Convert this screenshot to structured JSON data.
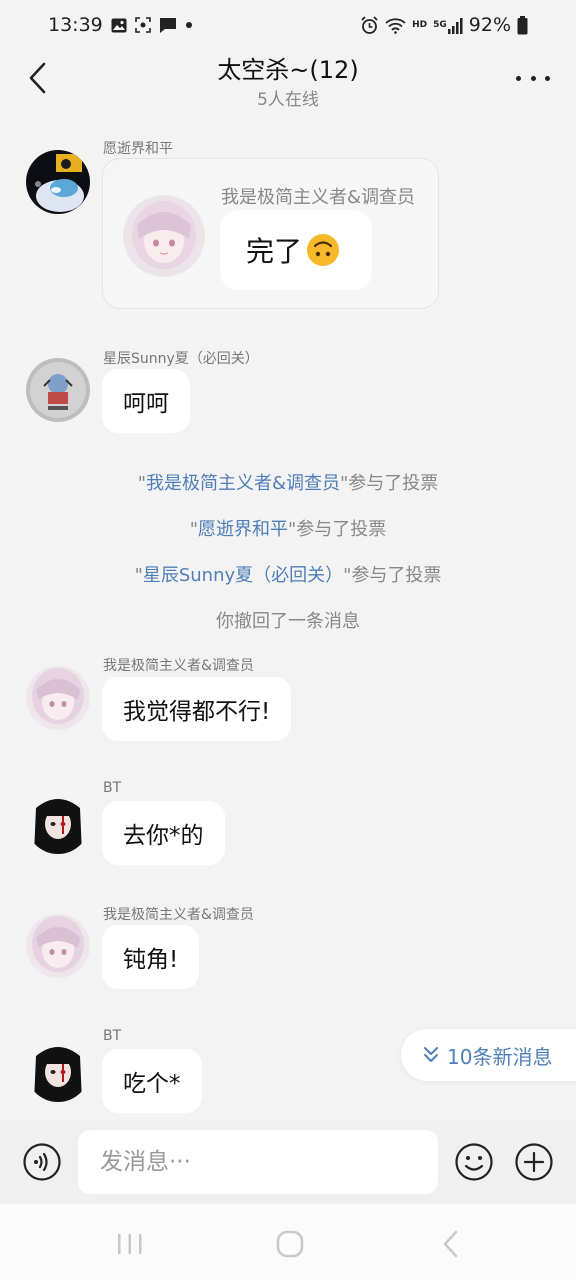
{
  "status_bar": {
    "time": "13:39",
    "network_label": "HD",
    "signal_label": "5G",
    "battery": "92%"
  },
  "header": {
    "title": "太空杀~(12)",
    "subtitle": "5人在线"
  },
  "messages": [
    {
      "sender": "愿逝界和平",
      "type": "quote-card",
      "card_sender": "我是极简主义者&调查员",
      "card_text": "完了"
    },
    {
      "sender": "星辰Sunny夏（必回关）",
      "text": "呵呵"
    },
    {
      "sender": "我是极简主义者&调查员",
      "text": "我觉得都不行!"
    },
    {
      "sender": "BT",
      "text": "去你*的"
    },
    {
      "sender": "我是极简主义者&调查员",
      "text": "钝角!"
    },
    {
      "sender": "BT",
      "text": "吃个*"
    }
  ],
  "system": [
    {
      "quote_open": "\"",
      "name": "我是极简主义者&调查员",
      "quote_close": "\"",
      "action": "参与了投票"
    },
    {
      "quote_open": "\"",
      "name": "愿逝界和平",
      "quote_close": "\"",
      "action": "参与了投票"
    },
    {
      "quote_open": "\"",
      "name": "星辰Sunny夏（必回关）",
      "quote_close": "\"",
      "action": "参与了投票"
    },
    {
      "text": "你撤回了一条消息"
    }
  ],
  "new_messages": "10条新消息",
  "input": {
    "placeholder": "发消息···"
  },
  "icons": {
    "back": "chevron-left-icon",
    "more": "more-icon",
    "voice": "voice-icon",
    "emoji": "smile-icon",
    "plus": "plus-icon",
    "scroll_down": "double-chevron-down-icon"
  },
  "colors": {
    "accent": "#4f7fb8",
    "background": "#f3f3f3",
    "bubble": "#ffffff"
  }
}
